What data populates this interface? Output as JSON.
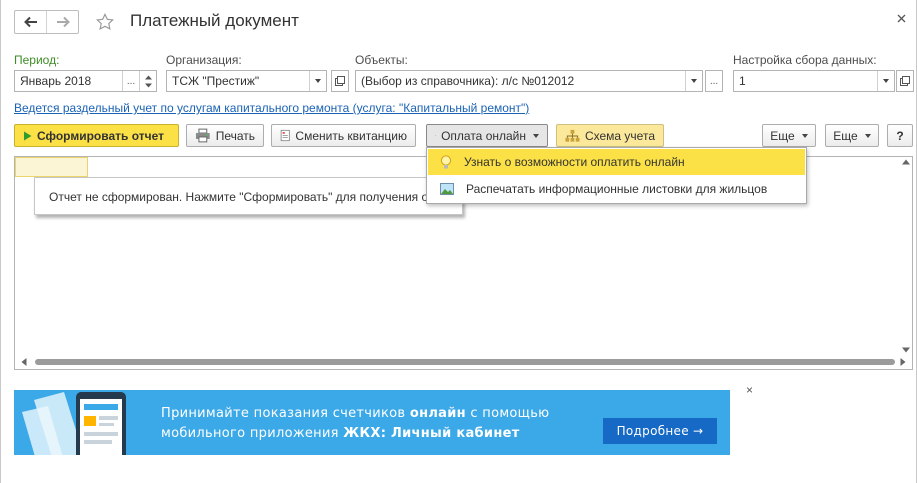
{
  "header": {
    "title": "Платежный документ"
  },
  "fields": {
    "period": {
      "label": "Период:",
      "value": "Январь 2018"
    },
    "organization": {
      "label": "Организация:",
      "value": "ТСЖ \"Престиж\""
    },
    "objects": {
      "label": "Объекты:",
      "value": "(Выбор из справочника): л/с №012012"
    },
    "settings": {
      "label": "Настройка сбора данных:",
      "value": "1"
    }
  },
  "link": {
    "text": "Ведется раздельный учет по услугам капитального ремонта (услуга: \"Капитальный ремонт\")"
  },
  "toolbar": {
    "generate": "Сформировать отчет",
    "print": "Печать",
    "change_receipt": "Сменить квитанцию",
    "online_payment": "Оплата онлайн",
    "accounting_scheme": "Схема учета",
    "more1": "Еще",
    "more2": "Еще",
    "help": "?"
  },
  "menu": {
    "items": [
      {
        "label": "Узнать о возможности оплатить онлайн",
        "icon": "lightbulb-icon"
      },
      {
        "label": "Распечатать информационные листовки для жильцов",
        "icon": "image-icon"
      }
    ]
  },
  "report": {
    "notice": "Отчет не сформирован. Нажмите \"Сформировать\" для получения отчета"
  },
  "banner": {
    "line1_pre": "Принимайте показания счетчиков ",
    "line1_bold": "онлайн",
    "line1_post": " с помощью",
    "line2_pre": "мобильного приложения ",
    "line2_bold": "ЖКХ: Личный кабинет",
    "button": "Подробнее →"
  },
  "colors": {
    "accent_yellow": "#fbe145",
    "link_blue": "#1b63b5",
    "banner_bg": "#3ba9e8",
    "banner_button": "#1669c4",
    "period_label_green": "#3f8d26"
  }
}
